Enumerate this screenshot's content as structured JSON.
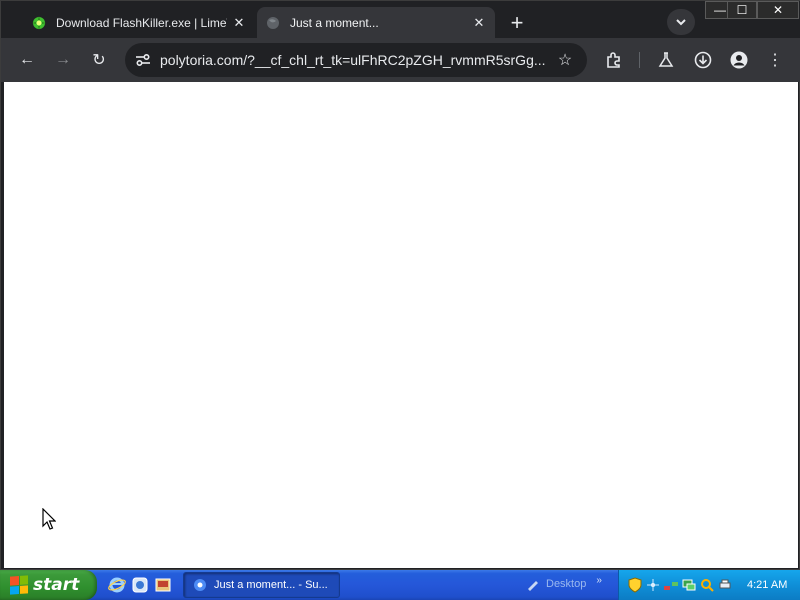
{
  "browser": {
    "tabs": [
      {
        "title": "Download FlashKiller.exe | LimeWi",
        "favicon": "limewire-icon",
        "close": "✕"
      },
      {
        "title": "Just a moment...",
        "favicon": "globe-loading-icon",
        "close": "✕",
        "active": true
      }
    ],
    "new_tab": "+",
    "tab_search": "⌄",
    "window_controls": {
      "minimize": "—",
      "maximize": "☐",
      "close": "✕"
    },
    "toolbar": {
      "back": "←",
      "forward": "→",
      "reload": "↻",
      "url": "polytoria.com/?__cf_chl_rt_tk=ulFhRC2pZGH_rvmmR5srGg...",
      "star": "☆",
      "menu": "⋮"
    }
  },
  "taskbar": {
    "start_label": "start",
    "task_button": "Just a moment... - Su...",
    "desktop_label": "Desktop",
    "desktop_chevron": "»",
    "clock": "4:21 AM"
  },
  "colors": {
    "browser_frame": "#202124",
    "toolbar": "#35363a",
    "taskbar_blue": "#245edb",
    "start_green": "#3c9a3a",
    "tray_blue": "#0f8fd8"
  }
}
